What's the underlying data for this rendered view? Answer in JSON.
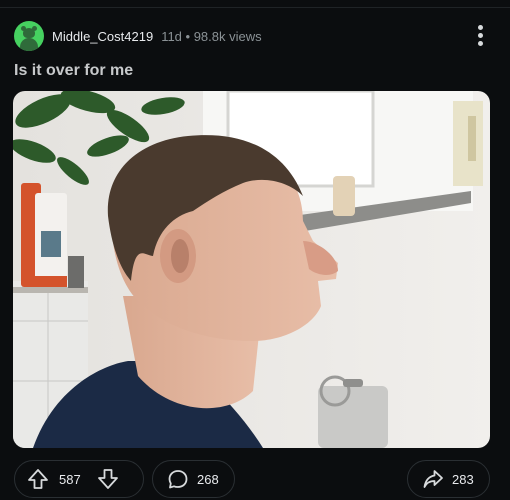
{
  "post": {
    "username": "Middle_Cost4219",
    "meta": "11d • 98.8k views",
    "title": "Is it over for me"
  },
  "actions": {
    "upvotes": "587",
    "comments": "268",
    "shares": "283"
  },
  "icons": [
    "avatar-icon",
    "more-options-icon",
    "upvote-icon",
    "downvote-icon",
    "comment-icon",
    "share-icon"
  ],
  "colors": {
    "background": "#0b0d0f",
    "avatar": "#46d160",
    "text": "#d7dadc"
  }
}
